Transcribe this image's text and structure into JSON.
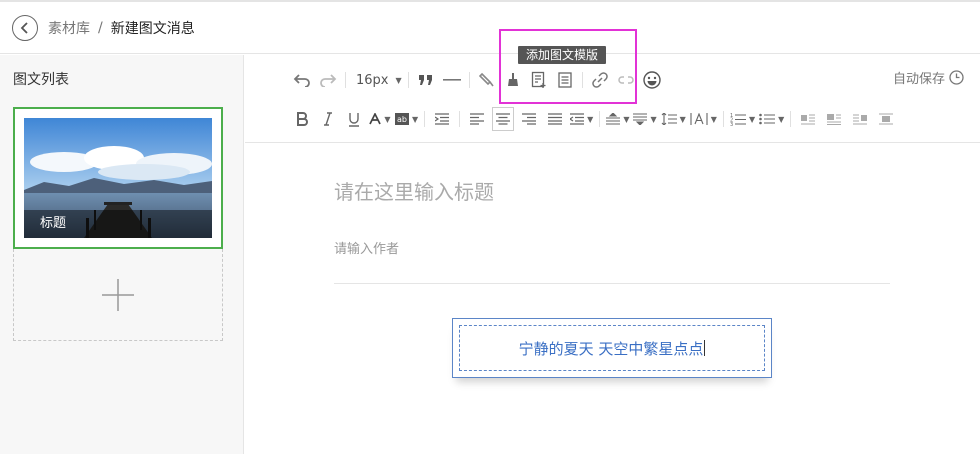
{
  "breadcrumb": {
    "parent": "素材库",
    "separator": "/",
    "current": "新建图文消息"
  },
  "sidebar": {
    "title": "图文列表",
    "articles": [
      {
        "label": "标题"
      }
    ]
  },
  "toolbar": {
    "font_size": "16px",
    "tooltip": "添加图文模版",
    "autosave_label": "自动保存",
    "row1_icons": [
      "undo-icon",
      "redo-icon",
      "font-size-select",
      "blockquote-icon",
      "horizontal-rule-icon",
      "format-brush-icon",
      "clear-format-icon",
      "add-template-icon",
      "template-icon",
      "link-icon",
      "unlink-icon",
      "emoji-icon"
    ],
    "row2_icons": [
      "bold-icon",
      "italic-icon",
      "underline-icon",
      "font-color-icon",
      "background-color-icon",
      "indent-icon",
      "align-left-icon",
      "align-center-icon",
      "align-right-icon",
      "align-justify-icon",
      "line-indent-icon",
      "paragraph-spacing-top-icon",
      "paragraph-spacing-bottom-icon",
      "line-height-icon",
      "letter-spacing-icon",
      "ordered-list-icon",
      "unordered-list-icon",
      "image-float-left-icon",
      "image-float-none-icon",
      "image-float-right-icon",
      "image-center-icon"
    ]
  },
  "editor": {
    "title_placeholder": "请在这里输入标题",
    "author_placeholder": "请输入作者",
    "template_text": "宁静的夏天 天空中繁星点点"
  }
}
